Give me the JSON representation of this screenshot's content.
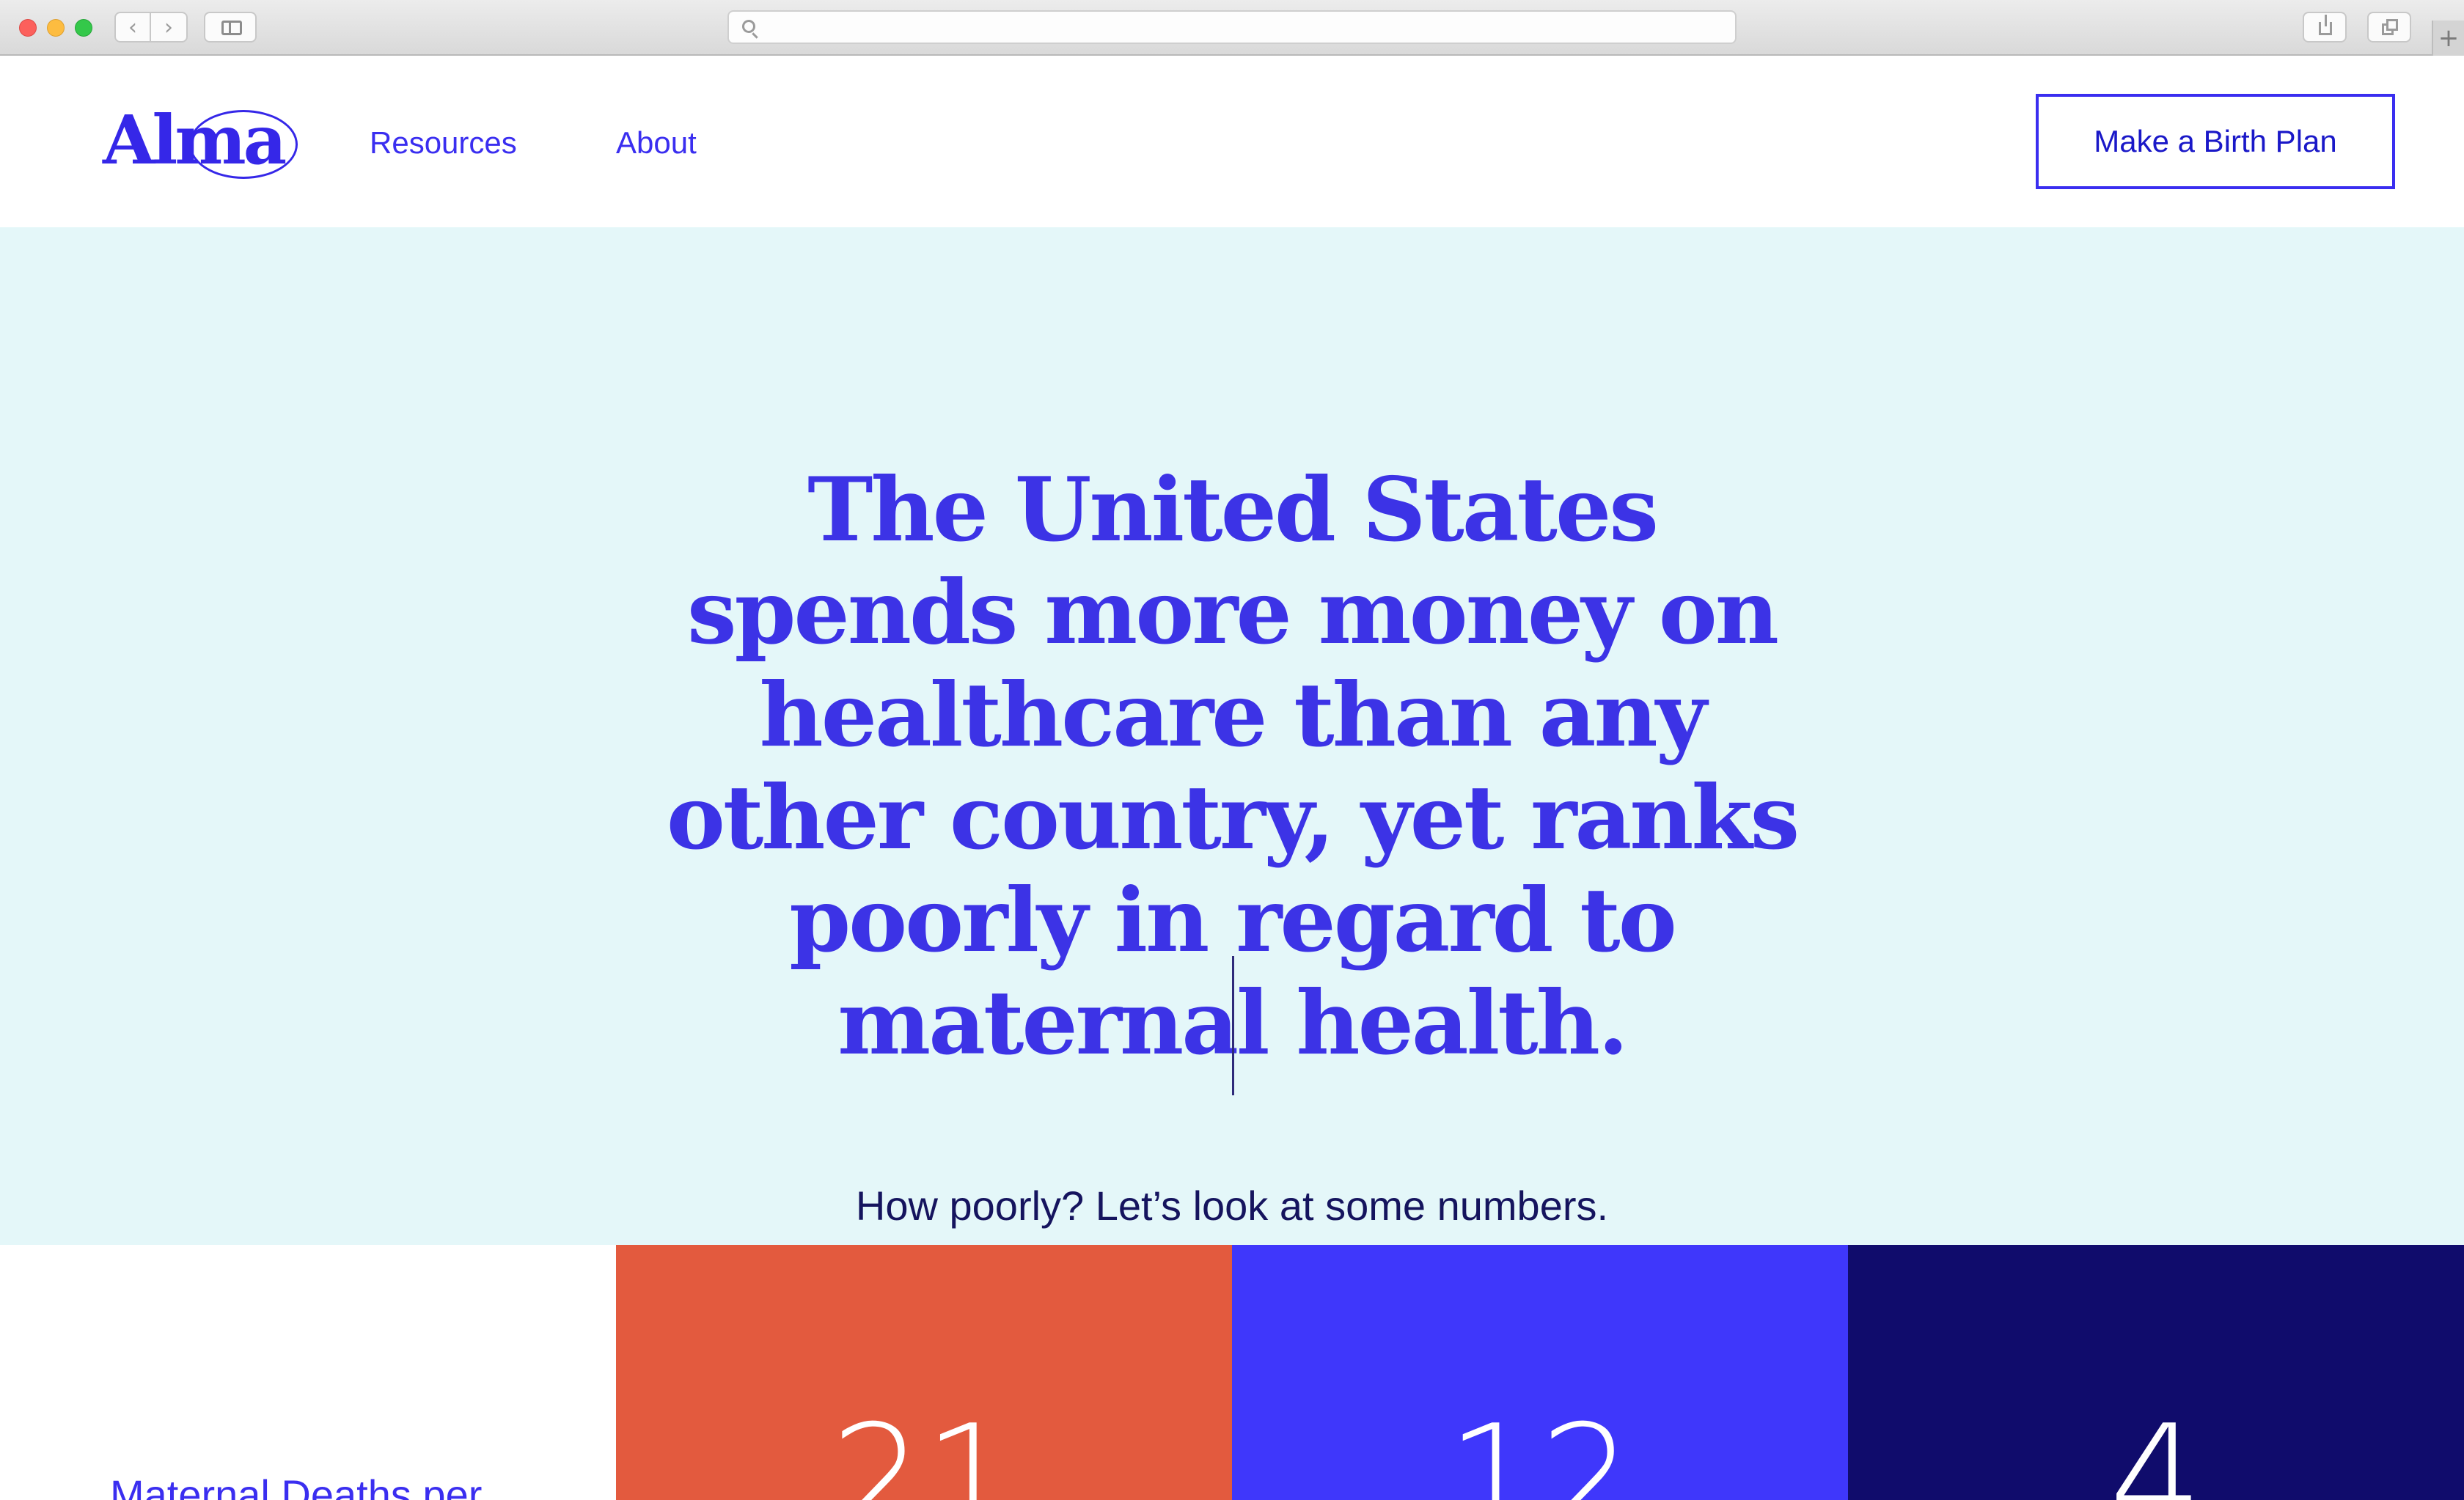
{
  "browser": {
    "back_icon": "‹",
    "forward_icon": "›",
    "new_tab_icon": "+",
    "url": ""
  },
  "header": {
    "logo": "Alma",
    "nav": [
      {
        "label": "Resources"
      },
      {
        "label": "About"
      }
    ],
    "cta_label": "Make a Birth Plan"
  },
  "hero": {
    "headline": "The United States spends more money on healthcare than any other country, yet ranks poorly in regard to maternal health.",
    "subtitle": "How poorly? Let’s look at some numbers."
  },
  "stats": {
    "label": "Maternal Deaths per",
    "cells": [
      {
        "value": "21",
        "color": "#e35a3e"
      },
      {
        "value": "12",
        "color": "#3f37fb"
      },
      {
        "value": "4",
        "color": "#100c6c"
      }
    ]
  },
  "colors": {
    "brand_blue": "#3a2ef0",
    "hero_bg": "#e4f7f9",
    "navy_text": "#15145e"
  }
}
